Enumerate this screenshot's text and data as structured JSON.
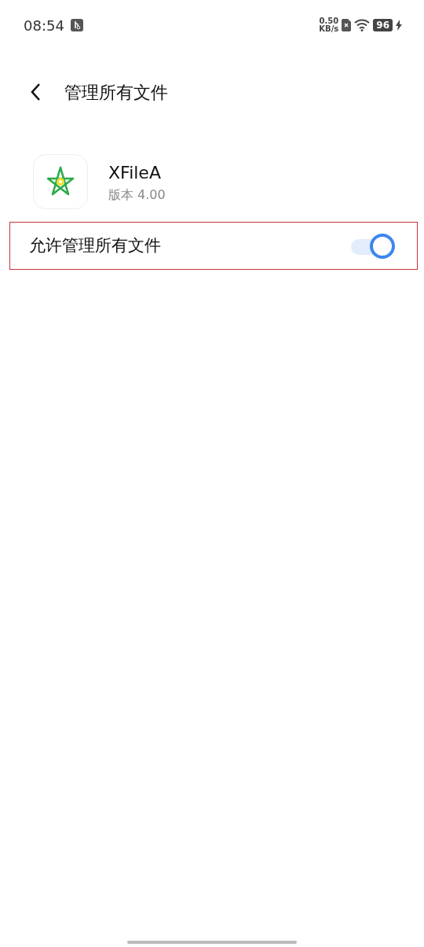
{
  "status_bar": {
    "time": "08:54",
    "speed_value": "0.50",
    "speed_unit": "KB/s",
    "battery": "96",
    "charging": true
  },
  "header": {
    "title": "管理所有文件"
  },
  "app": {
    "name": "XFileA",
    "version": "版本 4.00"
  },
  "setting": {
    "label": "允许管理所有文件",
    "on": true,
    "highlighted": true
  }
}
